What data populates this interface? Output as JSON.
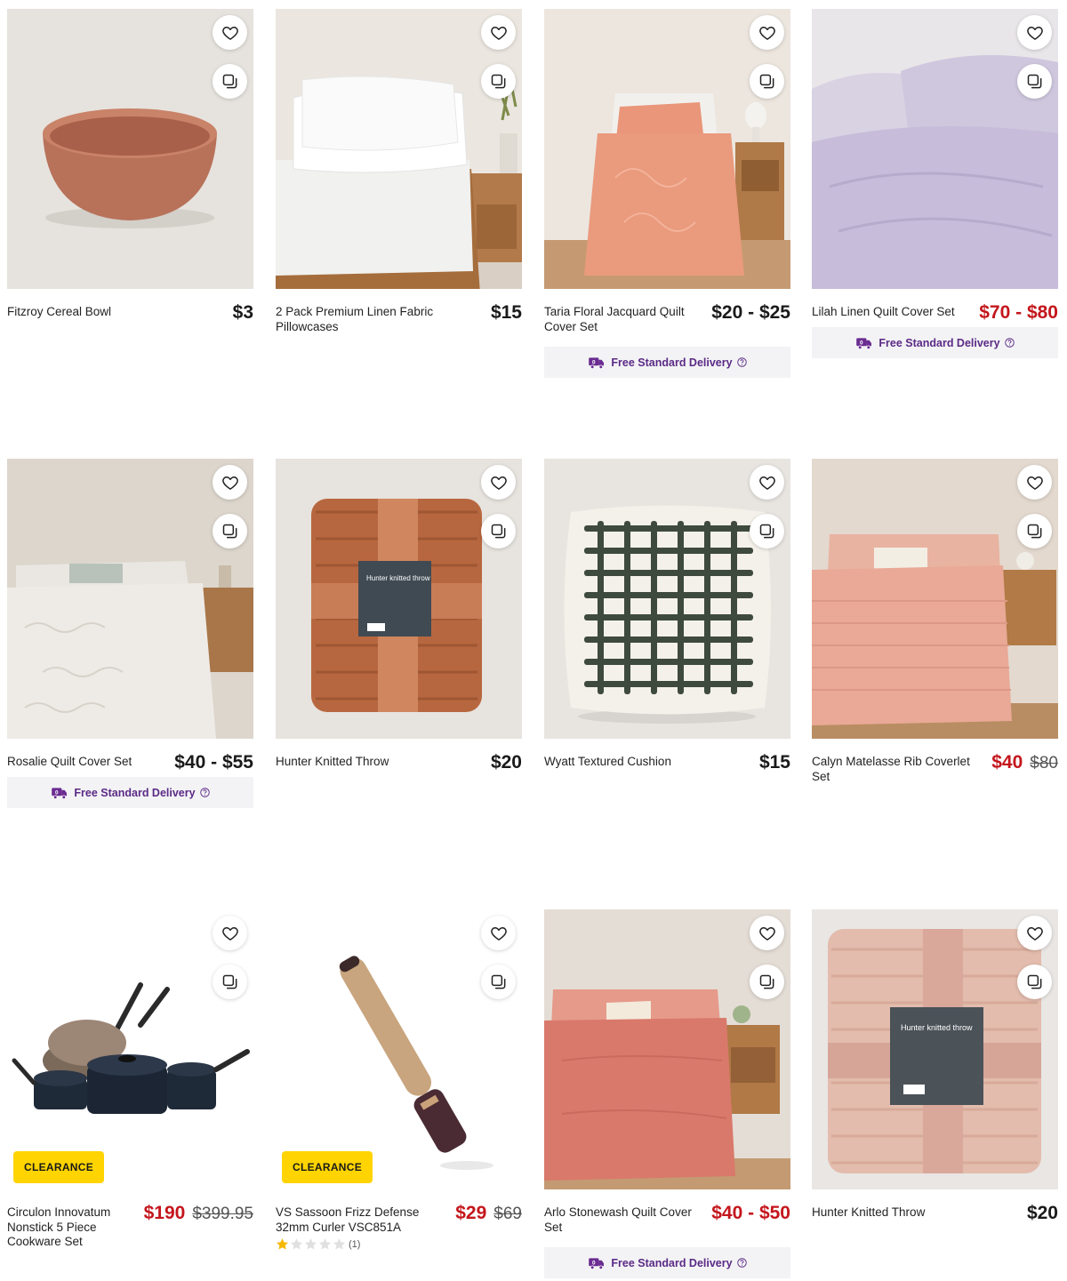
{
  "colors": {
    "accent_sale": "#c4161c",
    "delivery_purple": "#5b2a86",
    "clearance_yellow": "#ffd400",
    "delivery_bg": "#f3f3f5"
  },
  "icons": {
    "wishlist": "heart-icon",
    "compare": "compare-icon",
    "delivery": "truck-icon",
    "help": "question-circle-icon",
    "rating": "star-icon"
  },
  "products": [
    {
      "name": "Fitzroy Cereal Bowl",
      "price": "$3"
    },
    {
      "name": "2 Pack Premium Linen Fabric Pillowcases",
      "price": "$15"
    },
    {
      "name": "Taria Floral Jacquard Quilt Cover Set",
      "price": "$20 - $25",
      "delivery": "Free Standard Delivery"
    },
    {
      "name": "Lilah Linen Quilt Cover Set",
      "price": "$70 - $80",
      "delivery": "Free Standard Delivery"
    },
    {
      "name": "Rosalie Quilt Cover Set",
      "price": "$40 - $55",
      "delivery": "Free Standard Delivery"
    },
    {
      "name": "Hunter Knitted Throw",
      "price": "$20",
      "pack_label": "Hunter knitted throw"
    },
    {
      "name": "Wyatt Textured Cushion",
      "price": "$15"
    },
    {
      "name": "Calyn Matelasse Rib Coverlet Set",
      "price": "$40",
      "was_price": "$80"
    },
    {
      "name": "Circulon Innovatum Nonstick 5 Piece Cookware Set",
      "price": "$190",
      "was_price": "$399.95",
      "badge": "CLEARANCE"
    },
    {
      "name": "VS Sassoon Frizz Defense 32mm Curler VSC851A",
      "price": "$29",
      "was_price": "$69",
      "badge": "CLEARANCE",
      "rating": 1,
      "review_count": "(1)"
    },
    {
      "name": "Arlo Stonewash Quilt Cover Set",
      "price": "$40 - $50",
      "delivery": "Free Standard Delivery"
    },
    {
      "name": "Hunter Knitted Throw",
      "price": "$20",
      "pack_label": "Hunter knitted throw"
    }
  ]
}
